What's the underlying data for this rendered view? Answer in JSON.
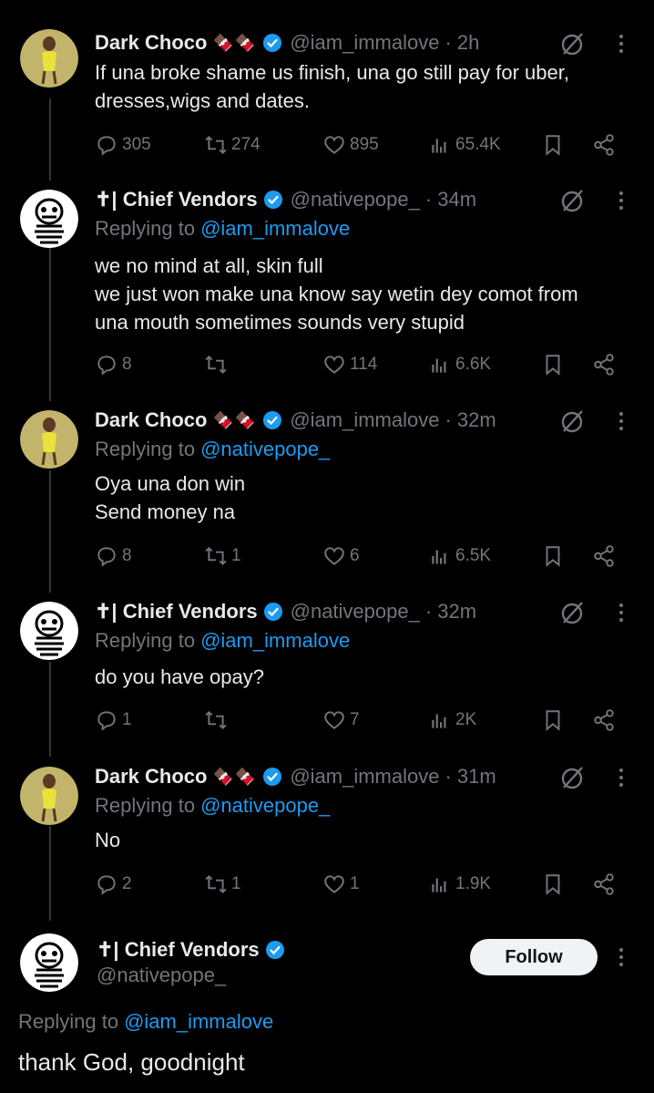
{
  "tweets": [
    {
      "name": "Dark Choco",
      "emoji": "🍫🍫",
      "handle": "@iam_immalove",
      "time": "· 2h",
      "replying_label": "",
      "replying_to": "",
      "text": "If una broke shame us finish, una go still pay for uber,\ndresses,wigs and dates.",
      "stats": {
        "replies": "305",
        "reposts": "274",
        "likes": "895",
        "views": "65.4K"
      }
    },
    {
      "name": "✝| Chief Vendors",
      "emoji": "",
      "handle": "@nativepope_",
      "time": "· 34m",
      "replying_label": "Replying to",
      "replying_to": "@iam_immalove",
      "text": "we no mind at all, skin full\nwe just won make una know say wetin dey comot from\nuna mouth sometimes sounds very stupid",
      "stats": {
        "replies": "8",
        "reposts": "",
        "likes": "114",
        "views": "6.6K"
      }
    },
    {
      "name": "Dark Choco",
      "emoji": "🍫🍫",
      "handle": "@iam_immalove",
      "time": "· 32m",
      "replying_label": "Replying to",
      "replying_to": "@nativepope_",
      "text": "Oya una don win\nSend money na",
      "stats": {
        "replies": "8",
        "reposts": "1",
        "likes": "6",
        "views": "6.5K"
      }
    },
    {
      "name": "✝| Chief Vendors",
      "emoji": "",
      "handle": "@nativepope_",
      "time": "· 32m",
      "replying_label": "Replying to",
      "replying_to": "@iam_immalove",
      "text": "do you have opay?",
      "stats": {
        "replies": "1",
        "reposts": "",
        "likes": "7",
        "views": "2K"
      }
    },
    {
      "name": "Dark Choco",
      "emoji": "🍫🍫",
      "handle": "@iam_immalove",
      "time": "· 31m",
      "replying_label": "Replying to",
      "replying_to": "@nativepope_",
      "text": "No",
      "stats": {
        "replies": "2",
        "reposts": "1",
        "likes": "1",
        "views": "1.9K"
      }
    }
  ],
  "main_tweet": {
    "name": "✝| Chief Vendors",
    "handle": "@nativepope_",
    "follow_label": "Follow",
    "replying_label": "Replying to",
    "replying_to": "@iam_immalove",
    "text": "thank God, goodnight"
  },
  "colors": {
    "background": "#000000",
    "text": "#e7e9ea",
    "muted": "#71767b",
    "link": "#1d9bf0",
    "verified": "#1d9bf0"
  },
  "icons": [
    "reply-icon",
    "repost-icon",
    "like-icon",
    "views-icon",
    "bookmark-icon",
    "share-icon",
    "grok-icon",
    "more-icon",
    "verified-icon"
  ]
}
